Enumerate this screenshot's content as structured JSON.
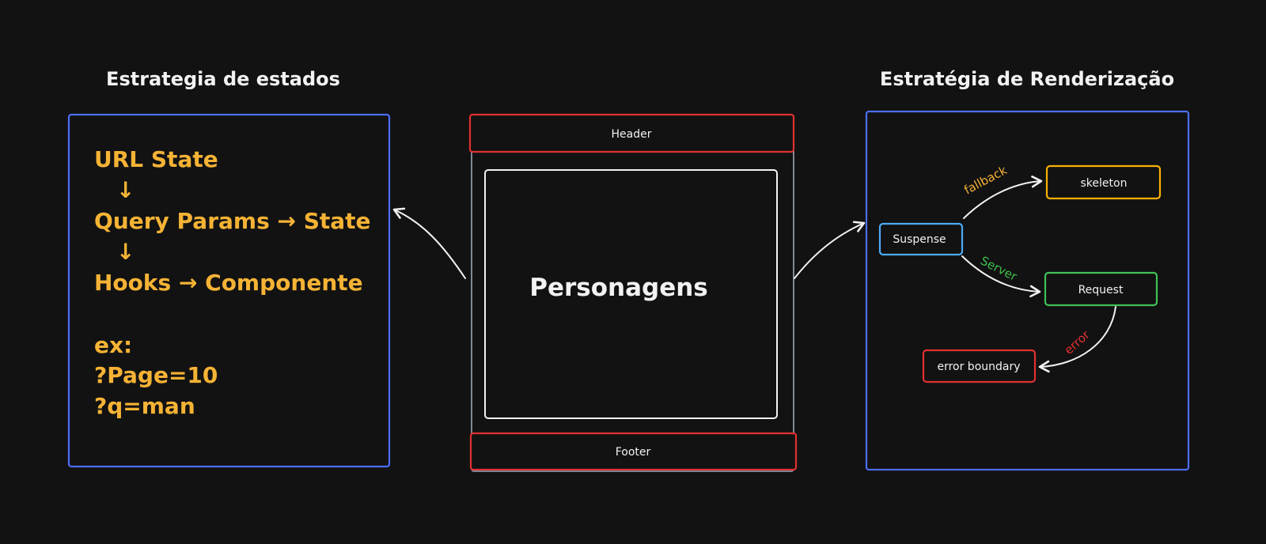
{
  "left_panel": {
    "title": "Estrategia de estados",
    "lines": [
      "URL State",
      "↓",
      "Query Params → State",
      "↓",
      "Hooks → Componente",
      "ex:",
      "?Page=10",
      "?q=man"
    ]
  },
  "center_panel": {
    "header": "Header",
    "content": "Personagens",
    "footer": "Footer"
  },
  "right_panel": {
    "title": "Estratégia de Renderização",
    "nodes": {
      "suspense": "Suspense",
      "skeleton": "skeleton",
      "request": "Request",
      "error_boundary": "error boundary"
    },
    "edges": {
      "fallback": "fallback",
      "server": "Server",
      "error": "error"
    }
  },
  "colors": {
    "background": "#121212",
    "frame_blue": "#4c6ef5",
    "frame_red": "#e03131",
    "frame_gray": "#8d95a8",
    "text_white": "#f2f2f2",
    "text_orange": "#f5b335",
    "node_blue": "#4dabf7",
    "node_yellow": "#fab005",
    "node_green": "#40c057",
    "node_red": "#e03131"
  }
}
